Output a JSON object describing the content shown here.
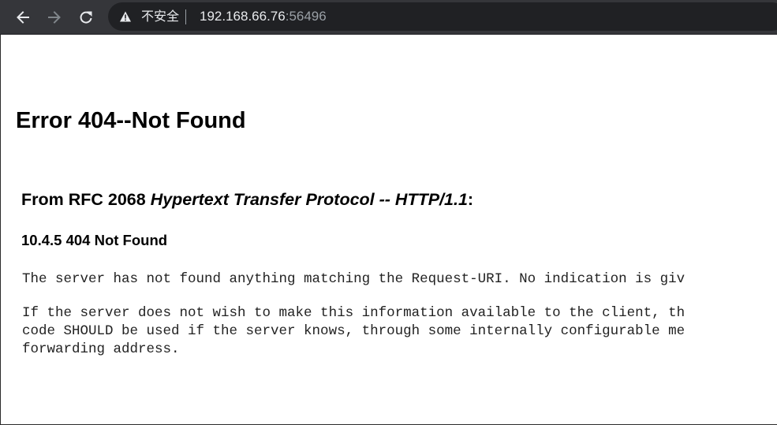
{
  "browser": {
    "security_label": "不安全",
    "url_host": "192.168.66.76",
    "url_port": ":56496",
    "icons": {
      "back": "arrow-left-icon",
      "forward": "arrow-right-icon",
      "reload": "reload-icon",
      "security": "warning-triangle-icon"
    },
    "colors": {
      "toolbar_bg": "#35363a",
      "omnibox_bg": "#202124",
      "text": "#e8eaed",
      "muted": "#9aa0a6"
    }
  },
  "page": {
    "title": "Error 404--Not Found",
    "rfc_heading_prefix": "From RFC 2068 ",
    "rfc_heading_italic": "Hypertext Transfer Protocol -- HTTP/1.1",
    "rfc_heading_suffix": ":",
    "section_heading": "10.4.5 404 Not Found",
    "paragraph_1": "The server has not found anything matching the Request-URI. No indication is giv",
    "paragraph_2": "If the server does not wish to make this information available to the client, th\ncode SHOULD be used if the server knows, through some internally configurable me\nforwarding address."
  }
}
